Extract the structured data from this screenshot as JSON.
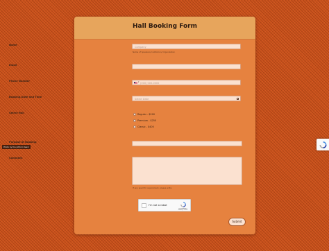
{
  "form": {
    "title": "Hall Booking Form",
    "fields": {
      "name": {
        "label": "Name",
        "placeholder": "Company",
        "sublabel": "Name of Speakers/ Institution/ Organization"
      },
      "email": {
        "label": "Email",
        "placeholder": ""
      },
      "phone": {
        "label": "Phone Number",
        "placeholder": "(000) 000-0000",
        "flag_icon": "us-flag-icon"
      },
      "booking_date": {
        "label": "Booking Date and Time",
        "placeholder": "Select Date",
        "icon": "calendar-icon"
      },
      "hall": {
        "label": "Select Hall",
        "options": [
          "Regular - $200",
          "Premium - $250",
          "Classic - $400"
        ]
      },
      "purpose": {
        "label": "Purpose of Booking",
        "placeholder": ""
      },
      "comment": {
        "label": "Comment",
        "sublabel": "If any specific requirement, please write"
      }
    },
    "captcha": {
      "checkbox_label": "I'm not a robot",
      "brand": "reCAPTCHA",
      "links": "Privacy - Terms"
    },
    "submit_label": "Submit"
  },
  "photo_credit": "Photo by the Jotform team",
  "colors": {
    "background": "#c9521c",
    "card": "#e6823f",
    "header": "#e7a55c",
    "input": "#fbe1d0"
  }
}
